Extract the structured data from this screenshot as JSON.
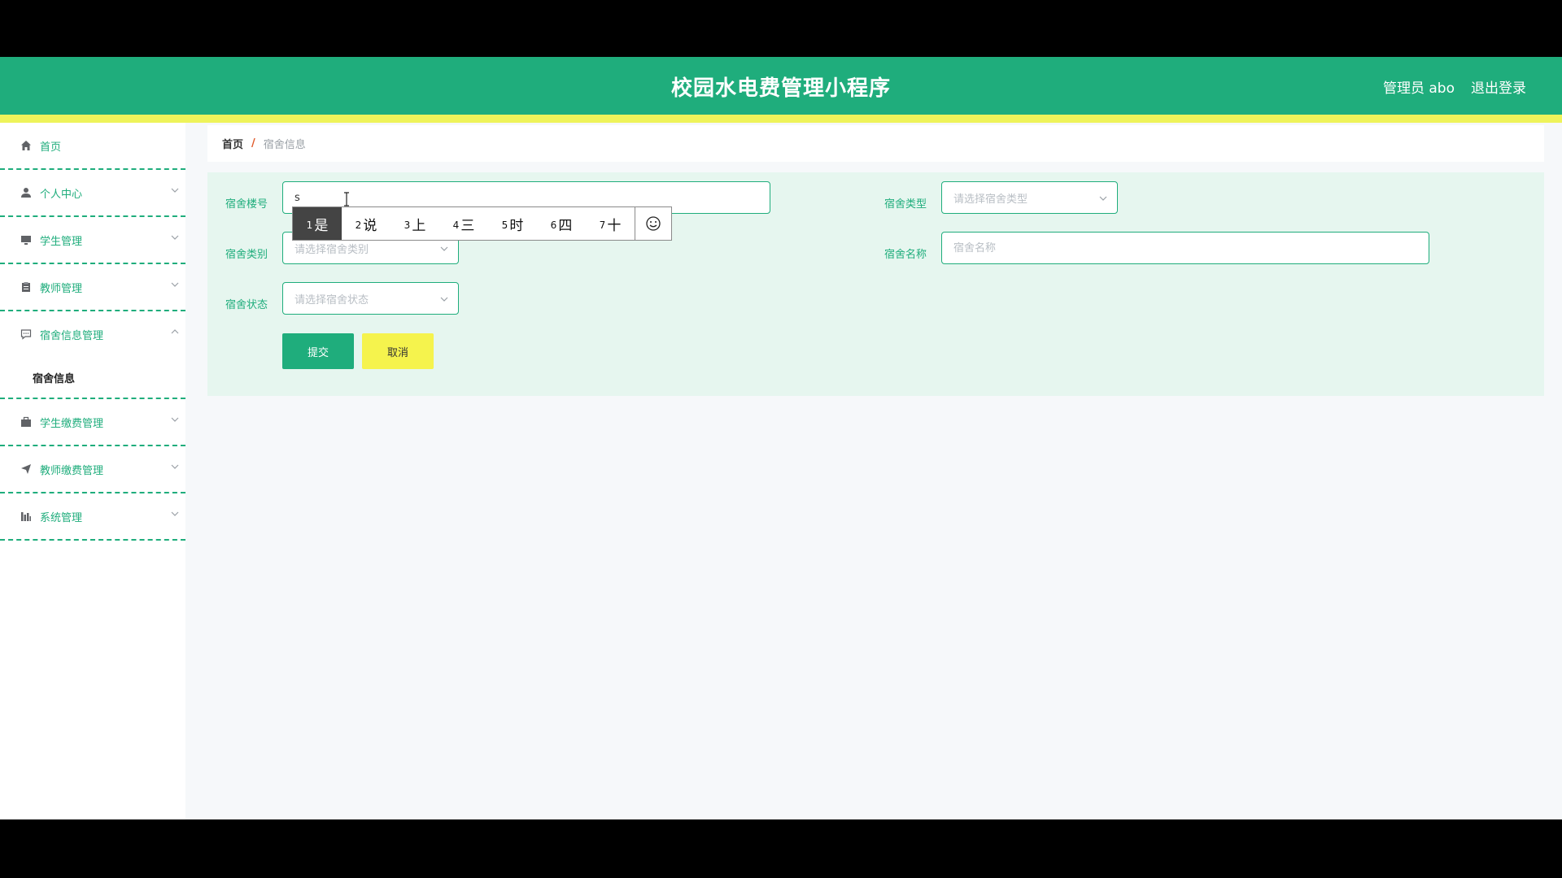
{
  "header": {
    "title": "校园水电费管理小程序",
    "user_label": "管理员 abo",
    "logout_label": "退出登录"
  },
  "colors": {
    "primary": "#1fad7c",
    "accent_yellow": "#f5f34d",
    "panel_bg": "#e6f6ef"
  },
  "sidebar": {
    "items": [
      {
        "label": "首页",
        "icon": "home-icon"
      },
      {
        "label": "个人中心",
        "icon": "user-icon"
      },
      {
        "label": "学生管理",
        "icon": "monitor-icon"
      },
      {
        "label": "教师管理",
        "icon": "clipboard-icon"
      },
      {
        "label": "宿舍信息管理",
        "icon": "comment-icon",
        "children": [
          {
            "label": "宿舍信息"
          }
        ]
      },
      {
        "label": "学生缴费管理",
        "icon": "briefcase-icon"
      },
      {
        "label": "教师缴费管理",
        "icon": "send-icon"
      },
      {
        "label": "系统管理",
        "icon": "chart-icon"
      }
    ]
  },
  "breadcrumb": {
    "home": "首页",
    "separator": "/",
    "current": "宿舍信息"
  },
  "form": {
    "building_label": "宿舍楼号",
    "building_value": "s",
    "type_label": "宿舍类型",
    "type_placeholder": "请选择宿舍类型",
    "category_label": "宿舍类别",
    "category_placeholder": "请选择宿舍类别",
    "name_label": "宿舍名称",
    "name_placeholder": "宿舍名称",
    "status_label": "宿舍状态",
    "status_placeholder": "请选择宿舍状态",
    "submit_label": "提交",
    "cancel_label": "取消"
  },
  "ime": {
    "candidates": [
      {
        "num": "1",
        "text": "是"
      },
      {
        "num": "2",
        "text": "说"
      },
      {
        "num": "3",
        "text": "上"
      },
      {
        "num": "4",
        "text": "三"
      },
      {
        "num": "5",
        "text": "时"
      },
      {
        "num": "6",
        "text": "四"
      },
      {
        "num": "7",
        "text": "十"
      }
    ],
    "emoji_icon": "smiley-icon"
  }
}
